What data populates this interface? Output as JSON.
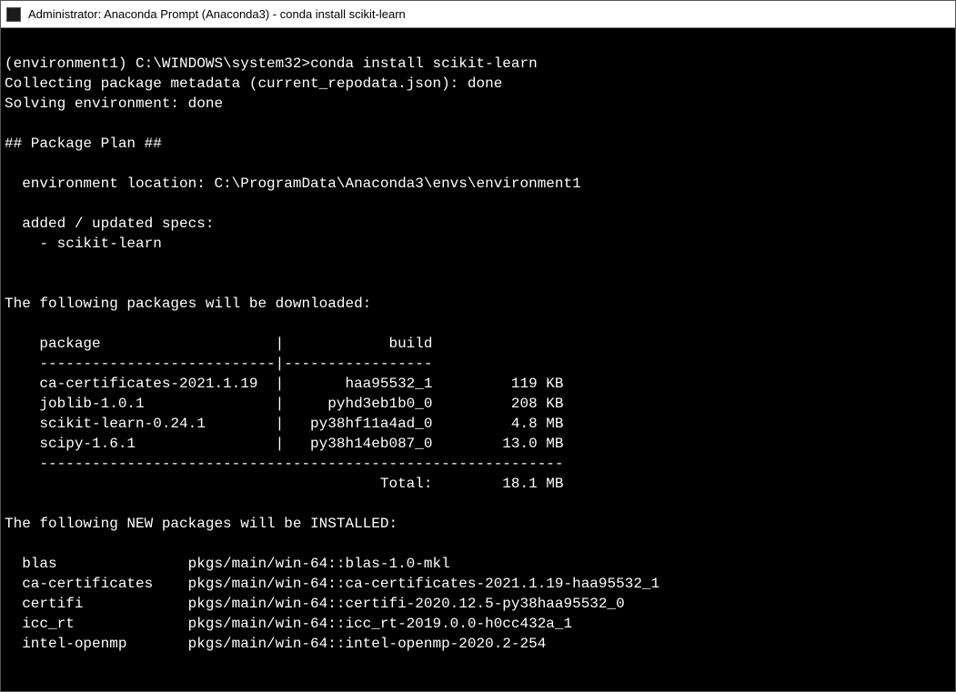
{
  "window": {
    "title": "Administrator: Anaconda Prompt (Anaconda3) - conda  install scikit-learn"
  },
  "term": {
    "prompt_env": "(environment1) ",
    "prompt_path": "C:\\WINDOWS\\system32>",
    "command": "conda install scikit-learn",
    "line_collecting": "Collecting package metadata (current_repodata.json): done",
    "line_solving": "Solving environment: done",
    "blank": "",
    "plan_header": "## Package Plan ##",
    "env_location": "  environment location: C:\\ProgramData\\Anaconda3\\envs\\environment1",
    "added_specs_header": "  added / updated specs:",
    "added_specs_item": "    - scikit-learn",
    "downloads_header": "The following packages will be downloaded:",
    "dl_table_header": "    package                    |            build",
    "dl_table_divider_top": "    ---------------------------|-----------------",
    "dl_row_0": "    ca-certificates-2021.1.19  |       haa95532_1         119 KB",
    "dl_row_1": "    joblib-1.0.1               |     pyhd3eb1b0_0         208 KB",
    "dl_row_2": "    scikit-learn-0.24.1        |   py38hf11a4ad_0         4.8 MB",
    "dl_row_3": "    scipy-1.6.1                |   py38h14eb087_0        13.0 MB",
    "dl_table_divider_bot": "    ------------------------------------------------------------",
    "dl_total": "                                           Total:        18.1 MB",
    "install_header": "The following NEW packages will be INSTALLED:",
    "inst_row_0": "  blas               pkgs/main/win-64::blas-1.0-mkl",
    "inst_row_1": "  ca-certificates    pkgs/main/win-64::ca-certificates-2021.1.19-haa95532_1",
    "inst_row_2": "  certifi            pkgs/main/win-64::certifi-2020.12.5-py38haa95532_0",
    "inst_row_3": "  icc_rt             pkgs/main/win-64::icc_rt-2019.0.0-h0cc432a_1",
    "inst_row_4": "  intel-openmp       pkgs/main/win-64::intel-openmp-2020.2-254"
  }
}
